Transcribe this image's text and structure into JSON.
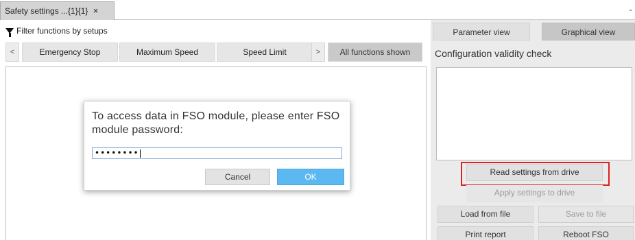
{
  "document_tab": {
    "title": "Safety settings ...{1}{1}",
    "close_glyph": "×"
  },
  "filter": {
    "label": "Filter functions by setups",
    "icon": "funnel-icon"
  },
  "function_tabs": {
    "prev": "<",
    "next": ">",
    "items": [
      "Emergency Stop",
      "Maximum Speed",
      "Speed Limit"
    ],
    "all": "All functions shown"
  },
  "dialog": {
    "message": "To access data in FSO module, please enter FSO module password:",
    "password_value": "••••••••",
    "cancel_label": "Cancel",
    "ok_label": "OK",
    "ok_color": "#5bb8f0"
  },
  "right_panel": {
    "view_tabs": {
      "parameter": "Parameter view",
      "graphical": "Graphical view"
    },
    "validity_title": "Configuration validity check",
    "buttons": {
      "read": "Read settings from drive",
      "apply": "Apply settings to drive",
      "load": "Load from file",
      "save": "Save to file",
      "print": "Print report",
      "reboot": "Reboot FSO"
    },
    "highlight_color": "#e02020"
  }
}
